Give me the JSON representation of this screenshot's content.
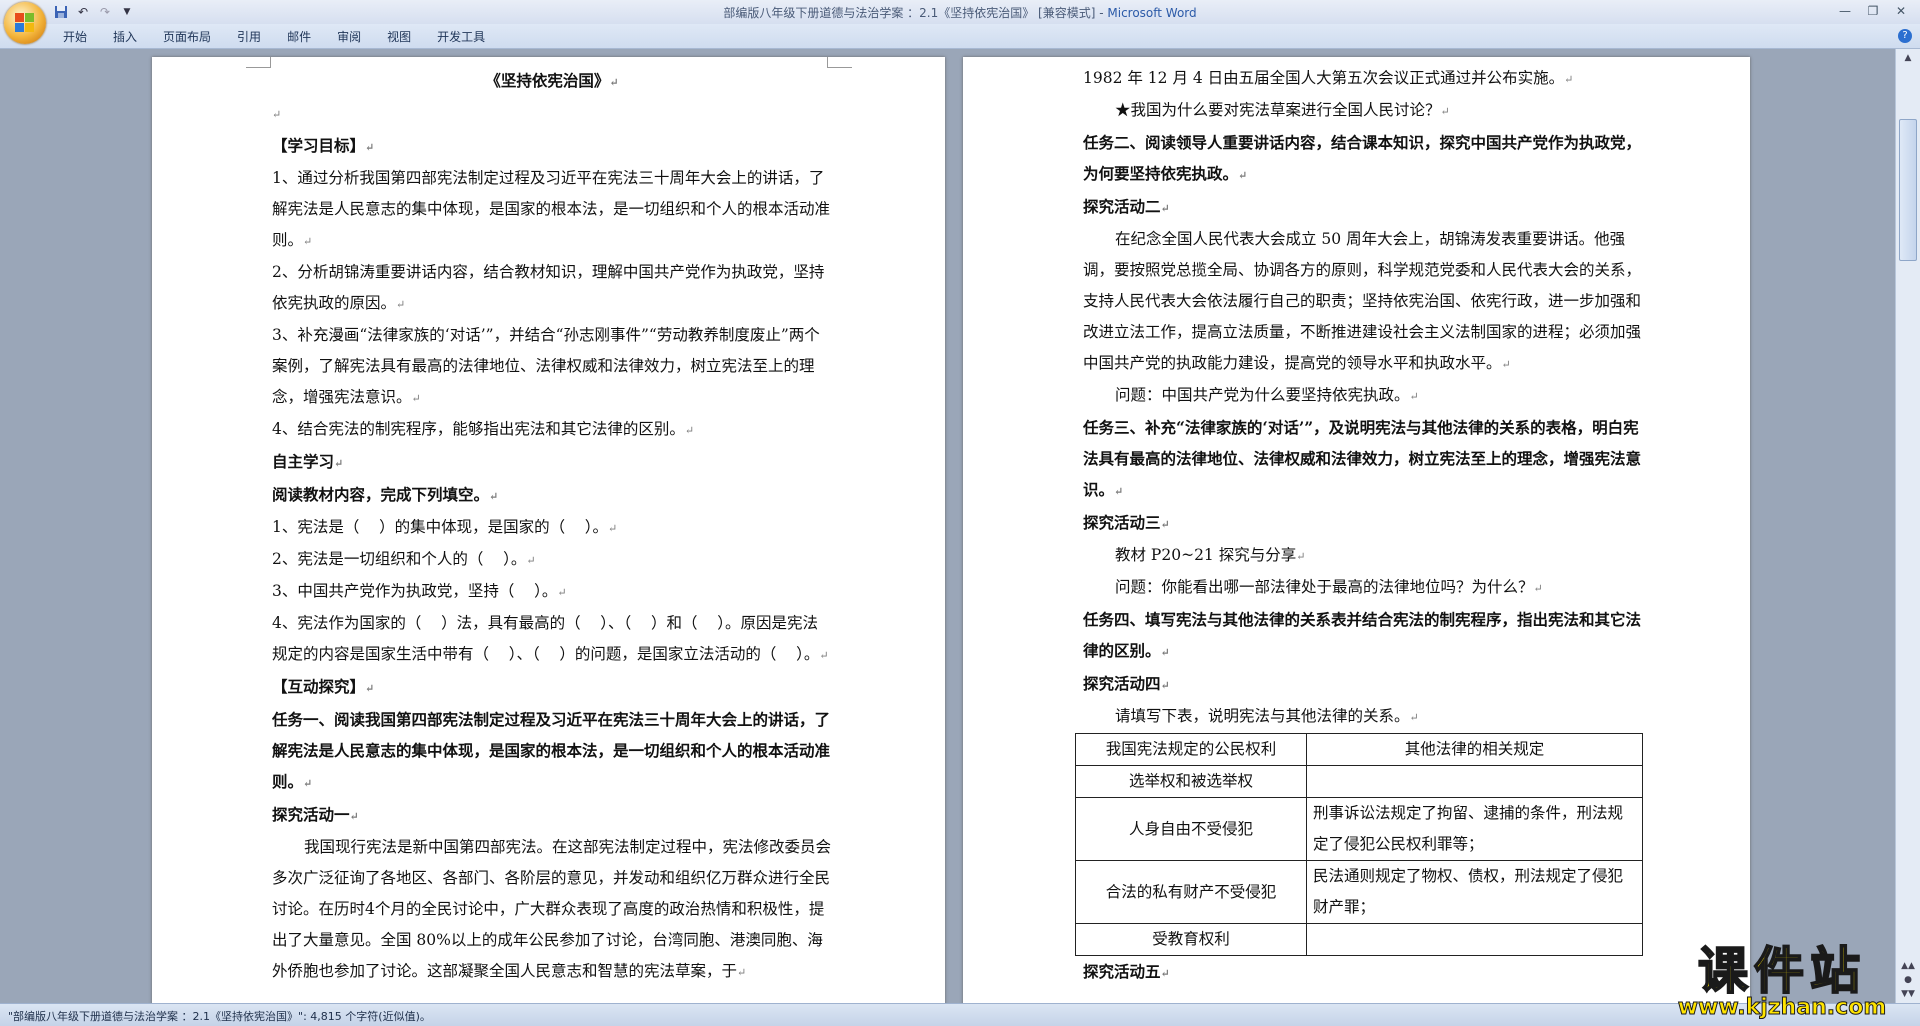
{
  "window": {
    "title": "部编版八年级下册道德与法治学案 ：2.1《坚持依宪治国》 [兼容模式] - ",
    "app_name": "Microsoft Word"
  },
  "quick_access": [
    "save-icon",
    "undo-icon",
    "redo-icon",
    "customize-icon"
  ],
  "ribbon": {
    "tabs": [
      "开始",
      "插入",
      "页面布局",
      "引用",
      "邮件",
      "审阅",
      "视图",
      "开发工具"
    ]
  },
  "page1": {
    "title": "《坚持依宪治国》",
    "lines": [
      {
        "t": "",
        "cls": ""
      },
      {
        "t": "【学习目标】",
        "cls": "b"
      },
      {
        "t": "1、通过分析我国第四部宪法制定过程及习近平在宪法三十周年大会上的讲话，了解宪法是人民意志的集中体现，是国家的根本法，是一切组织和个人的根本活动准则。",
        "cls": ""
      },
      {
        "t": "2、分析胡锦涛重要讲话内容，结合教材知识，理解中国共产党作为执政党，坚持依宪执政的原因。",
        "cls": ""
      },
      {
        "t": "3、补充漫画“法律家族的‘对话’”，并结合“孙志刚事件”“劳动教养制度废止”两个案例，了解宪法具有最高的法律地位、法律权威和法律效力，树立宪法至上的理念，增强宪法意识。",
        "cls": ""
      },
      {
        "t": "4、结合宪法的制宪程序，能够指出宪法和其它法律的区别。",
        "cls": ""
      },
      {
        "t": "自主学习",
        "cls": "b"
      },
      {
        "t": "阅读教材内容，完成下列填空。",
        "cls": "b"
      },
      {
        "t": "1、宪法是（    ）的集中体现，是国家的（    ）。",
        "cls": ""
      },
      {
        "t": "2、宪法是一切组织和个人的（    ）。",
        "cls": ""
      },
      {
        "t": "3、中国共产党作为执政党，坚持（    ）。",
        "cls": ""
      },
      {
        "t": "4、宪法作为国家的（    ）法，具有最高的（    ）、（    ）和（    ）。原因是宪法规定的内容是国家生活中带有（    ）、（    ）的问题，是国家立法活动的（    ）。",
        "cls": ""
      },
      {
        "t": "【互动探究】",
        "cls": "b"
      },
      {
        "t": "任务一、阅读我国第四部宪法制定过程及习近平在宪法三十周年大会上的讲话，了解宪法是人民意志的集中体现，是国家的根本法，是一切组织和个人的根本活动准则。",
        "cls": "b"
      },
      {
        "t": "探究活动一",
        "cls": "b"
      },
      {
        "t": "我国现行宪法是新中国第四部宪法。在这部宪法制定过程中，宪法修改委员会多次广泛征询了各地区、各部门、各阶层的意见，并发动和组织亿万群众进行全民讨论。在历时4个月的全民讨论中，广大群众表现了高度的政治热情和积极性，提出了大量意见。全国 80%以上的成年公民参加了讨论，台湾同胞、港澳同胞、海外侨胞也参加了讨论。这部凝聚全国人民意志和智慧的宪法草案，于",
        "cls": "ind"
      }
    ]
  },
  "page2": {
    "lines_before_table": [
      {
        "t": "1982 年 12 月 4 日由五届全国人大第五次会议正式通过并公布实施。",
        "cls": ""
      },
      {
        "t": "★我国为什么要对宪法草案进行全国人民讨论？",
        "cls": "ind"
      },
      {
        "t": "任务二、阅读领导人重要讲话内容，结合课本知识，探究中国共产党作为执政党，为何要坚持依宪执政。",
        "cls": "b"
      },
      {
        "t": "探究活动二",
        "cls": "b"
      },
      {
        "t": "在纪念全国人民代表大会成立 50 周年大会上，胡锦涛发表重要讲话。他强调，要按照党总揽全局、协调各方的原则，科学规范党委和人民代表大会的关系，支持人民代表大会依法履行自己的职责；坚持依宪治国、依宪行政，进一步加强和改进立法工作，提高立法质量，不断推进建设社会主义法制国家的进程；必须加强中国共产党的执政能力建设，提高党的领导水平和执政水平。",
        "cls": "ind"
      },
      {
        "t": "问题：中国共产党为什么要坚持依宪执政。",
        "cls": "ind"
      },
      {
        "t": "任务三、补充“法律家族的‘对话’”，及说明宪法与其他法律的关系的表格，明白宪法具有最高的法律地位、法律权威和法律效力，树立宪法至上的理念，增强宪法意识。",
        "cls": "b"
      },
      {
        "t": "探究活动三",
        "cls": "b"
      },
      {
        "t": "教材 P20~21 探究与分享",
        "cls": "ind"
      },
      {
        "t": "问题：你能看出哪一部法律处于最高的法律地位吗？为什么？",
        "cls": "ind"
      },
      {
        "t": "任务四、填写宪法与其他法律的关系表并结合宪法的制宪程序，指出宪法和其它法律的区别。",
        "cls": "b"
      },
      {
        "t": "探究活动四",
        "cls": "b"
      },
      {
        "t": "请填写下表，说明宪法与其他法律的关系。",
        "cls": "ind"
      }
    ],
    "table": {
      "headers": [
        "我国宪法规定的公民权利",
        "其他法律的相关规定"
      ],
      "rows": [
        [
          "选举权和被选举权",
          ""
        ],
        [
          "人身自由不受侵犯",
          "刑事诉讼法规定了拘留、逮捕的条件，刑法规定了侵犯公民权利罪等；"
        ],
        [
          "合法的私有财产不受侵犯",
          "民法通则规定了物权、债权，刑法规定了侵犯财产罪；"
        ],
        [
          "受教育权利",
          ""
        ]
      ]
    },
    "lines_after_table": [
      {
        "t": "探究活动五",
        "cls": "b"
      }
    ]
  },
  "status": {
    "text": "\"部编版八年级下册道德与法治学案 ：2.1《坚持依宪治国》\": 4,815 个字符(近似值)。"
  },
  "watermark": {
    "logo": "课件站",
    "url": "www.kjzhan.com"
  }
}
